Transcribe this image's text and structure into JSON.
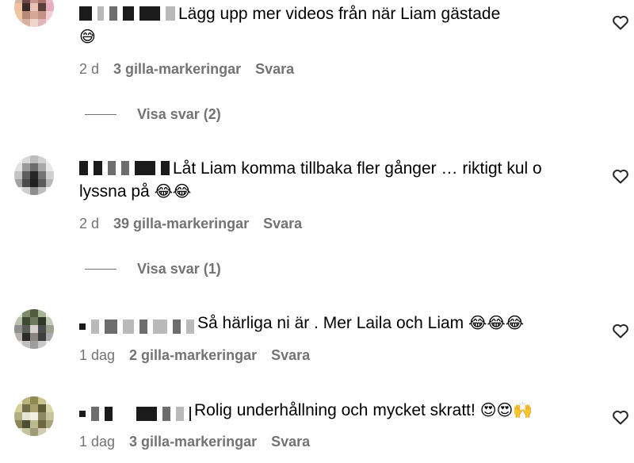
{
  "comments": [
    {
      "text": "Lägg upp mer videos från när Liam gästade",
      "emoji": "😅",
      "time": "2 d",
      "likes": "3 gilla-markeringar",
      "reply": "Svara",
      "view_replies": "Visa svar (2)"
    },
    {
      "text": "Låt Liam komma tillbaka fler gånger … riktigt kul o lyssna på",
      "emoji": "😂😂",
      "time": "2 d",
      "likes": "39 gilla-markeringar",
      "reply": "Svara",
      "view_replies": "Visa svar (1)"
    },
    {
      "text": "Så härliga ni är . Mer Laila och Liam",
      "emoji": "😂😂😂",
      "time": "1 dag",
      "likes": "2 gilla-markeringar",
      "reply": "Svara"
    },
    {
      "text": "Rolig underhållning och mycket skratt!",
      "emoji": "😍😍🙌",
      "time": "1 dag",
      "likes": "3 gilla-markeringar",
      "reply": "Svara"
    }
  ],
  "icons": {
    "like": "heart-outline-icon"
  },
  "colors": {
    "text": "#000000",
    "muted": "#737373",
    "background": "#ffffff"
  }
}
